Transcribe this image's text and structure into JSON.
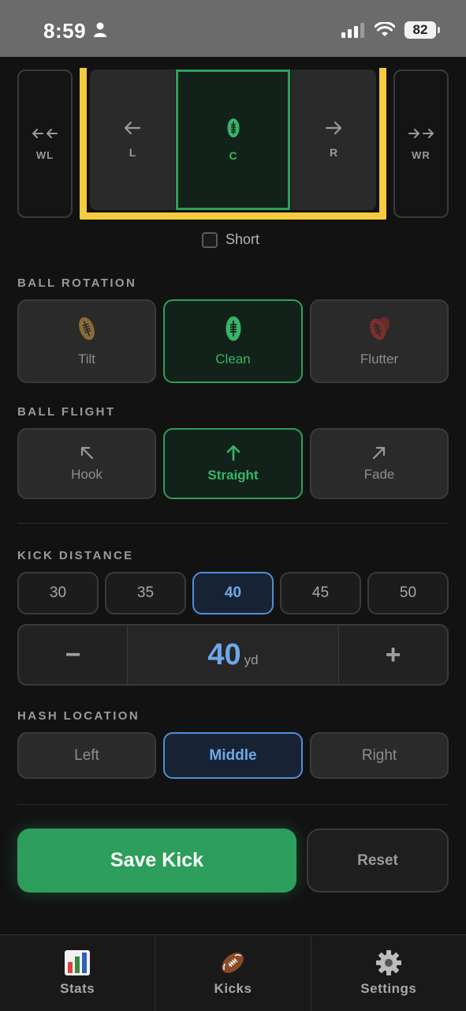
{
  "status_bar": {
    "time": "8:59",
    "battery": "82"
  },
  "goal": {
    "wing_left": "WL",
    "zone_left": "L",
    "zone_center": "C",
    "zone_right": "R",
    "wing_right": "WR",
    "selected": "C"
  },
  "short_label": "Short",
  "ball_rotation": {
    "title": "BALL ROTATION",
    "options": [
      "Tilt",
      "Clean",
      "Flutter"
    ],
    "selected": "Clean"
  },
  "ball_flight": {
    "title": "BALL FLIGHT",
    "options": [
      "Hook",
      "Straight",
      "Fade"
    ],
    "selected": "Straight"
  },
  "kick_distance": {
    "title": "KICK DISTANCE",
    "presets": [
      "30",
      "35",
      "40",
      "45",
      "50"
    ],
    "selected": "40",
    "minus": "−",
    "plus": "+",
    "value": "40",
    "unit": "yd"
  },
  "hash_location": {
    "title": "HASH LOCATION",
    "options": [
      "Left",
      "Middle",
      "Right"
    ],
    "selected": "Middle"
  },
  "actions": {
    "save": "Save Kick",
    "reset": "Reset"
  },
  "tabs": [
    {
      "label": "Stats",
      "icon": "bar-chart-icon"
    },
    {
      "label": "Kicks",
      "icon": "football-icon"
    },
    {
      "label": "Settings",
      "icon": "gear-icon"
    }
  ],
  "colors": {
    "accent_green": "#2f9e5a",
    "accent_blue": "#4f8fd6",
    "goal_yellow": "#f5cc3f"
  }
}
